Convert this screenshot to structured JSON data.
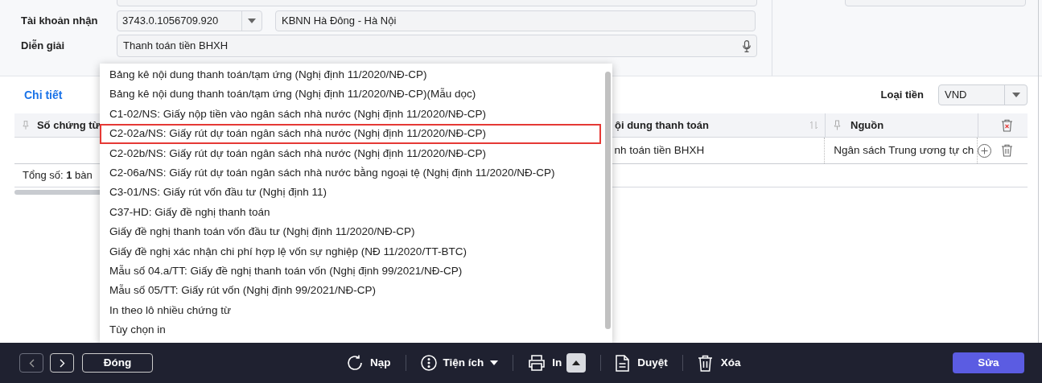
{
  "form": {
    "account_label": "Tài khoản nhận",
    "account_value": "3743.0.1056709.920",
    "bank_value": "KBNN Hà Đông - Hà Nội",
    "description_label": "Diễn giải",
    "description_value": "Thanh toán tiền BHXH"
  },
  "detail": {
    "title": "Chi tiết",
    "currency_label": "Loại tiền",
    "currency_value": "VND"
  },
  "table": {
    "columns": [
      "Số chứng từ",
      "ội dung thanh toán",
      "Nguồn"
    ],
    "rows": [
      [
        "",
        "nh toán tiền BHXH",
        "Ngân sách Trung ương tự ch"
      ]
    ],
    "total": "Tổng số: **1** bàn"
  },
  "print_menu": [
    {
      "label": "Bảng kê nội dung thanh toán/tạm ứng (Nghị định 11/2020/NĐ-CP)",
      "selected": false
    },
    {
      "label": "Bảng kê nội dung thanh toán/tạm ứng (Nghị định 11/2020/NĐ-CP)(Mẫu dọc)",
      "selected": false
    },
    {
      "label": "C1-02/NS: Giấy nộp tiền vào ngân sách nhà nước (Nghị định 11/2020/NĐ-CP)",
      "selected": false
    },
    {
      "label": "C2-02a/NS: Giấy rút dự toán ngân sách nhà nước (Nghị định 11/2020/NĐ-CP)",
      "selected": true
    },
    {
      "label": "C2-02b/NS: Giấy rút dự toán ngân sách nhà nước (Nghị định 11/2020/NĐ-CP)",
      "selected": false
    },
    {
      "label": "C2-06a/NS: Giấy rút dự toán ngân sách nhà nước bằng ngoại tệ (Nghị định 11/2020/NĐ-CP)",
      "selected": false
    },
    {
      "label": "C3-01/NS: Giấy rút vốn đầu tư (Nghị định 11)",
      "selected": false
    },
    {
      "label": "C37-HD: Giấy đề nghị thanh toán",
      "selected": false
    },
    {
      "label": "Giấy đề nghị thanh toán vốn đầu tư (Nghị định 11/2020/NĐ-CP)",
      "selected": false
    },
    {
      "label": "Giấy đề nghị xác nhận chi phí hợp lệ vốn sự nghiệp (NĐ 11/2020/TT-BTC)",
      "selected": false
    },
    {
      "label": "Mẫu số 04.a/TT: Giấy đề nghị thanh toán vốn (Nghị định 99/2021/NĐ-CP)",
      "selected": false
    },
    {
      "label": "Mẫu số 05/TT: Giấy rút vốn (Nghị định 99/2021/NĐ-CP)",
      "selected": false
    },
    {
      "label": "In theo lô nhiều chứng từ",
      "selected": false
    },
    {
      "label": "Tùy chọn in",
      "selected": false
    }
  ],
  "toolbar": {
    "close": "Đóng",
    "reload": "Nạp",
    "utilities": "Tiện ích",
    "print": "In",
    "approve": "Duyệt",
    "delete": "Xóa",
    "edit": "Sửa"
  }
}
